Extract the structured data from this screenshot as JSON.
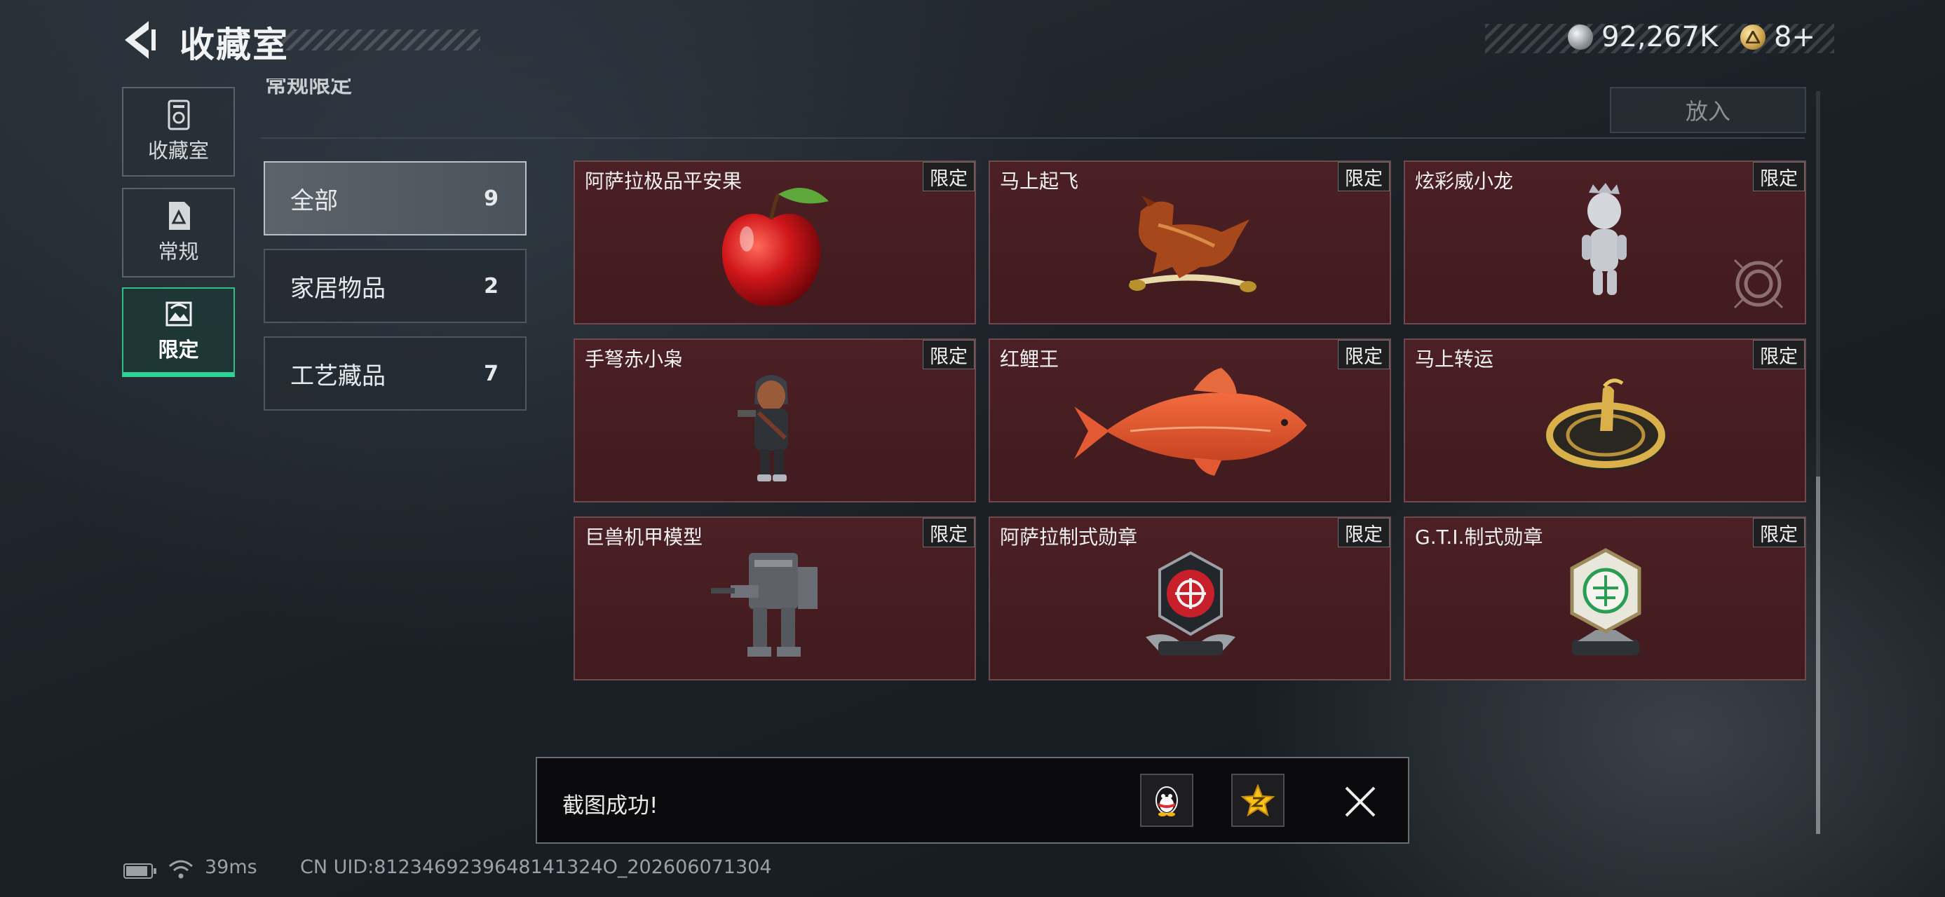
{
  "header": {
    "title": "收藏室",
    "currencies": [
      {
        "icon": "silver-coin-icon",
        "value": "92,267K"
      },
      {
        "icon": "gold-triangle-coin-icon",
        "value": "8+"
      }
    ]
  },
  "nav": {
    "items": [
      {
        "label": "收藏室",
        "icon": "trophy-icon",
        "active": false
      },
      {
        "label": "常规",
        "icon": "document-icon",
        "active": false
      },
      {
        "label": "限定",
        "icon": "image-frame-icon",
        "active": true
      }
    ]
  },
  "section": {
    "title": "常规限定",
    "put_label": "放入"
  },
  "categories": [
    {
      "label": "全部",
      "count": "9",
      "active": true
    },
    {
      "label": "家居物品",
      "count": "2",
      "active": false
    },
    {
      "label": "工艺藏品",
      "count": "7",
      "active": false
    }
  ],
  "items": [
    {
      "name": "阿萨拉极品平安果",
      "badge": "限定",
      "art": "red-apple-icon"
    },
    {
      "name": "马上起飞",
      "badge": "限定",
      "art": "horse-on-scroll-icon"
    },
    {
      "name": "炫彩威小龙",
      "badge": "限定",
      "art": "silver-figurine-icon"
    },
    {
      "name": "手弩赤小枭",
      "badge": "限定",
      "art": "hooded-figure-icon"
    },
    {
      "name": "红鲤王",
      "badge": "限定",
      "art": "red-carp-icon"
    },
    {
      "name": "马上转运",
      "badge": "限定",
      "art": "golden-wheel-icon"
    },
    {
      "name": "巨兽机甲模型",
      "badge": "限定",
      "art": "mech-model-icon"
    },
    {
      "name": "阿萨拉制式勋章",
      "badge": "限定",
      "art": "red-medal-icon"
    },
    {
      "name": "G.T.I.制式勋章",
      "badge": "限定",
      "art": "green-medal-icon"
    }
  ],
  "toast": {
    "text": "截图成功!",
    "share_icons": [
      "qq-penguin-icon",
      "qzone-star-icon"
    ]
  },
  "status": {
    "battery_icon": "battery-icon",
    "wifi_icon": "wifi-icon",
    "ping": "39ms",
    "uid": "CN UID:8123469239648141324O_202606071304"
  },
  "colors": {
    "accent_green": "#2fd494",
    "card_bg": "#4b2024",
    "badge_bg": "#1f1f22"
  }
}
